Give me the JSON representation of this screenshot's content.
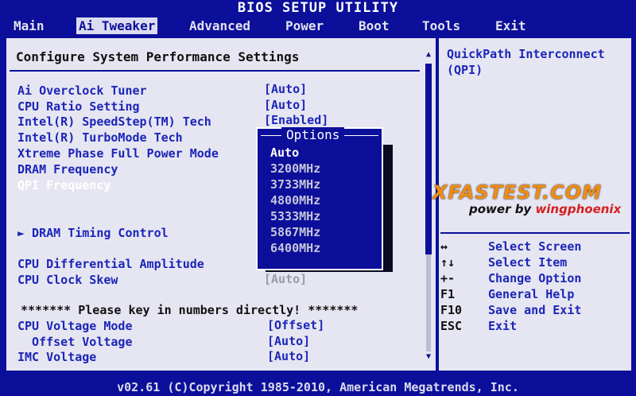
{
  "window": {
    "title": "BIOS SETUP UTILITY"
  },
  "menu": [
    {
      "label": "Main",
      "active": false
    },
    {
      "label": "Ai Tweaker",
      "active": true
    },
    {
      "label": "Advanced",
      "active": false
    },
    {
      "label": "Power",
      "active": false
    },
    {
      "label": "Boot",
      "active": false
    },
    {
      "label": "Tools",
      "active": false
    },
    {
      "label": "Exit",
      "active": false
    }
  ],
  "main": {
    "heading": "Configure System Performance Settings",
    "settings": [
      {
        "label": "Ai Overclock Tuner",
        "value": "[Auto]"
      },
      {
        "label": "CPU Ratio Setting",
        "value": "[Auto]"
      },
      {
        "label": "Intel(R) SpeedStep(TM) Tech",
        "value": "[Enabled]"
      },
      {
        "label": "Intel(R) TurboMode Tech",
        "value": ""
      },
      {
        "label": "Xtreme Phase Full Power Mode",
        "value": ""
      },
      {
        "label": "DRAM Frequency",
        "value": ""
      },
      {
        "label": "QPI Frequency",
        "value": ""
      }
    ],
    "submenu": "► DRAM Timing Control",
    "settings2": [
      {
        "label": "CPU Differential Amplitude",
        "value": ""
      },
      {
        "label": "CPU Clock Skew",
        "value": "[Auto]"
      }
    ],
    "notice": "******* Please key in numbers directly! *******",
    "settings3": [
      {
        "label": "CPU Voltage Mode",
        "value": "[Offset]"
      },
      {
        "label": "  Offset Voltage",
        "value": "[Auto]"
      },
      {
        "label": "IMC Voltage",
        "value": "[Auto]"
      }
    ]
  },
  "popup": {
    "title": "Options",
    "options": [
      "Auto",
      "3200MHz",
      "3733MHz",
      "4800MHz",
      "5333MHz",
      "5867MHz",
      "6400MHz"
    ],
    "selected_index": 0
  },
  "help": {
    "title": "QuickPath Interconnect (QPI)",
    "keys": [
      {
        "key": "↔",
        "desc": "Select Screen"
      },
      {
        "key": "↑↓",
        "desc": "Select Item"
      },
      {
        "key": "+-",
        "desc": "Change Option"
      },
      {
        "key": "F1",
        "desc": "General Help"
      },
      {
        "key": "F10",
        "desc": "Save and Exit"
      },
      {
        "key": "ESC",
        "desc": "Exit"
      }
    ]
  },
  "watermark": {
    "line1": "XFASTEST.COM",
    "line2a": "power by ",
    "line2b": "wingphoenix"
  },
  "footer": {
    "text": "v02.61 (C)Copyright 1985-2010, American Megatrends, Inc."
  },
  "colors": {
    "background": "#0c0f9a",
    "panel": "#e6e6f2",
    "text_blue": "#1c25b8"
  }
}
